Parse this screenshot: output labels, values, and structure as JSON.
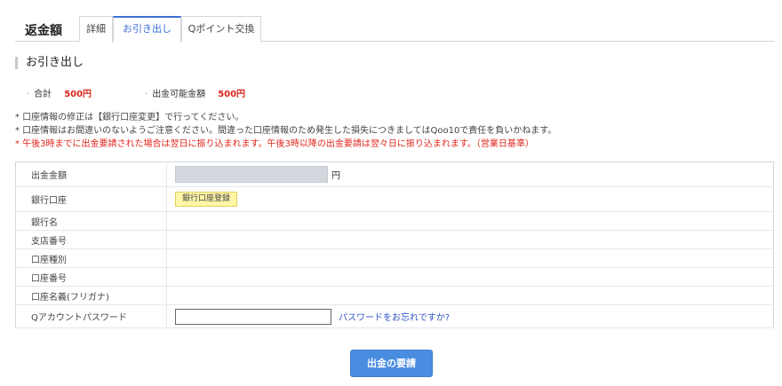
{
  "header": {
    "title": "返金額",
    "tabs": [
      {
        "label": "詳細"
      },
      {
        "label": "お引き出し"
      },
      {
        "label": "Qポイント交換"
      }
    ]
  },
  "section": {
    "title": "お引き出し"
  },
  "summary": {
    "total_label": "合計",
    "total_value": "500円",
    "available_label": "出金可能金額",
    "available_value": "500円"
  },
  "notes": [
    "* 口座情報の修正は【銀行口座変更】で行ってください。",
    "* 口座情報はお間違いのないようご注意ください。間違った口座情報のため発生した損失につきましてはQoo10で責任を負いかねます。",
    "* 午後3時までに出金要請された場合は翌日に振り込まれます。午後3時以降の出金要請は翌々日に振り込まれます。（営業日基準）"
  ],
  "form": {
    "amount_label": "出金金額",
    "amount_unit": "円",
    "bank_account_label": "銀行口座",
    "bank_register_button": "銀行口座登録",
    "bank_name_label": "銀行名",
    "branch_number_label": "支店番号",
    "account_type_label": "口座種別",
    "account_number_label": "口座番号",
    "account_holder_label": "口座名義(フリガナ)",
    "password_label": "Qアカウントパスワード",
    "password_value": "",
    "forgot_password_link": "パスワードをお忘れですか?"
  },
  "submit": {
    "label": "出金の要請"
  },
  "colors": {
    "accent": "#4a8de0",
    "highlight": "#fff6a8",
    "alert": "#e0251c",
    "link": "#2f55c6"
  }
}
